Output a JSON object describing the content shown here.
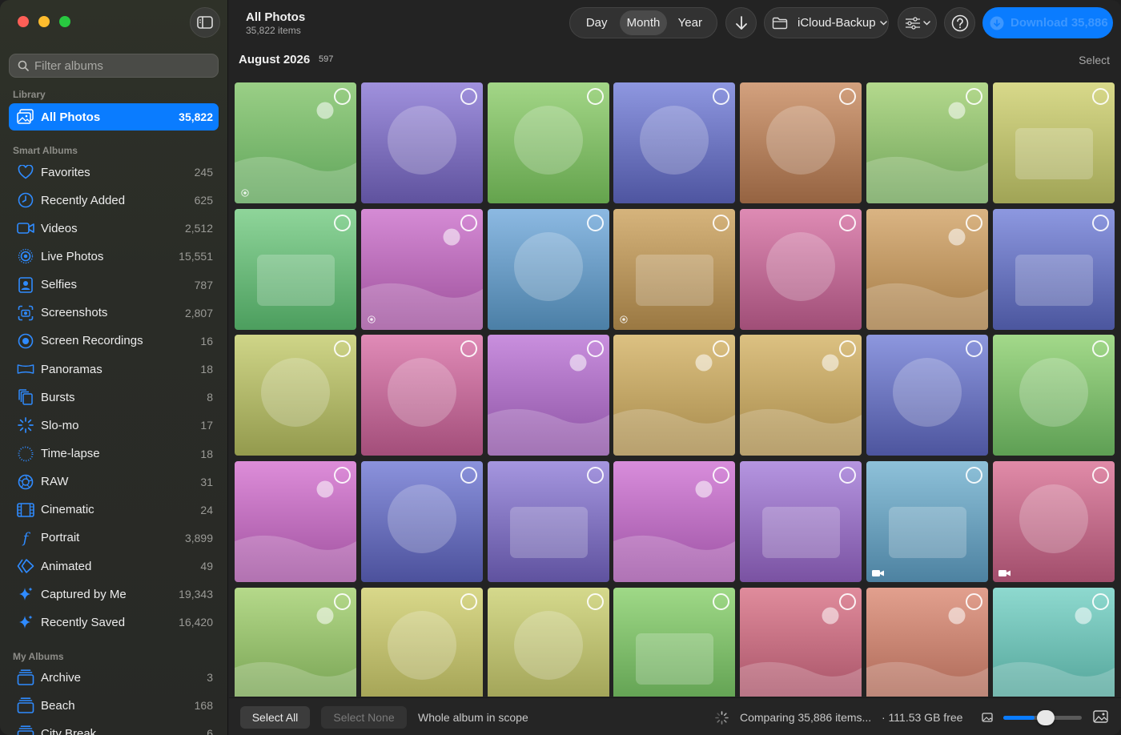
{
  "window": {
    "title": "All Photos",
    "subtitle": "35,822 items"
  },
  "sidebar": {
    "filter_placeholder": "Filter albums",
    "library_label": "Library",
    "library": [
      {
        "label": "All Photos",
        "count": "35,822",
        "icon": "photos-icon",
        "active": true
      }
    ],
    "smart_label": "Smart Albums",
    "smart": [
      {
        "label": "Favorites",
        "count": "245",
        "icon": "heart-icon"
      },
      {
        "label": "Recently Added",
        "count": "625",
        "icon": "clock-icon"
      },
      {
        "label": "Videos",
        "count": "2,512",
        "icon": "video-icon"
      },
      {
        "label": "Live Photos",
        "count": "15,551",
        "icon": "live-photo-icon"
      },
      {
        "label": "Selfies",
        "count": "787",
        "icon": "selfie-icon"
      },
      {
        "label": "Screenshots",
        "count": "2,807",
        "icon": "screenshot-icon"
      },
      {
        "label": "Screen Recordings",
        "count": "16",
        "icon": "screen-recording-icon"
      },
      {
        "label": "Panoramas",
        "count": "18",
        "icon": "panorama-icon"
      },
      {
        "label": "Bursts",
        "count": "8",
        "icon": "bursts-icon"
      },
      {
        "label": "Slo-mo",
        "count": "17",
        "icon": "slomo-icon"
      },
      {
        "label": "Time-lapse",
        "count": "18",
        "icon": "timelapse-icon"
      },
      {
        "label": "RAW",
        "count": "31",
        "icon": "raw-icon"
      },
      {
        "label": "Cinematic",
        "count": "24",
        "icon": "cinematic-icon"
      },
      {
        "label": "Portrait",
        "count": "3,899",
        "icon": "portrait-icon"
      },
      {
        "label": "Animated",
        "count": "49",
        "icon": "animated-icon"
      },
      {
        "label": "Captured by Me",
        "count": "19,343",
        "icon": "sparkle-icon"
      },
      {
        "label": "Recently Saved",
        "count": "16,420",
        "icon": "sparkle-icon"
      }
    ],
    "albums_label": "My Albums",
    "albums": [
      {
        "label": "Archive",
        "count": "3",
        "icon": "album-stack-icon"
      },
      {
        "label": "Beach",
        "count": "168",
        "icon": "album-stack-icon"
      },
      {
        "label": "City Break",
        "count": "6",
        "icon": "album-stack-icon"
      }
    ]
  },
  "toolbar": {
    "segments": [
      {
        "label": "Day"
      },
      {
        "label": "Month",
        "selected": true
      },
      {
        "label": "Year"
      }
    ],
    "folder_label": "iCloud-Backup",
    "download_label": "Download 35,886"
  },
  "content": {
    "month_title": "August 2026",
    "month_count": "597",
    "select_label": "Select"
  },
  "tiles": [
    {
      "top": "#9acf86",
      "bot": "#5fa45a",
      "shape": "dot",
      "badge": "live"
    },
    {
      "top": "#a091dd",
      "bot": "#5f529e",
      "shape": "circle"
    },
    {
      "top": "#a3d687",
      "bot": "#64a34d",
      "shape": "circle"
    },
    {
      "top": "#8e97e0",
      "bot": "#4e55a0",
      "shape": "circle"
    },
    {
      "top": "#d3a17e",
      "bot": "#956341",
      "shape": "circle"
    },
    {
      "top": "#b4d98d",
      "bot": "#6fa359",
      "shape": "dot"
    },
    {
      "top": "#d8d98a",
      "bot": "#a0a456",
      "shape": "rect"
    },
    {
      "top": "#8fd59a",
      "bot": "#4c9e5e",
      "shape": "rect"
    },
    {
      "top": "#d58bd5",
      "bot": "#9d509b",
      "shape": "dot",
      "badge": "live"
    },
    {
      "top": "#8cb9e2",
      "bot": "#4b7fa6",
      "shape": "circle"
    },
    {
      "top": "#d6b47c",
      "bot": "#9a7842",
      "shape": "rect",
      "badge": "live"
    },
    {
      "top": "#de8bb4",
      "bot": "#a04e77",
      "shape": "circle"
    },
    {
      "top": "#dab483",
      "bot": "#a37a44",
      "shape": "dot"
    },
    {
      "top": "#8d98e0",
      "bot": "#4b569e",
      "shape": "rect"
    },
    {
      "top": "#cfd588",
      "bot": "#939a4d",
      "shape": "circle"
    },
    {
      "top": "#e08bb7",
      "bot": "#a34e7a",
      "shape": "circle"
    },
    {
      "top": "#c98fde",
      "bot": "#8c52a3",
      "shape": "dot"
    },
    {
      "top": "#dcc182",
      "bot": "#a6894a",
      "shape": "dot"
    },
    {
      "top": "#dcc182",
      "bot": "#a6894a",
      "shape": "dot"
    },
    {
      "top": "#8d97de",
      "bot": "#4d559e",
      "shape": "circle"
    },
    {
      "top": "#a3d98a",
      "bot": "#5e9f54",
      "shape": "circle"
    },
    {
      "top": "#dd8dd9",
      "bot": "#9f509e",
      "shape": "dot"
    },
    {
      "top": "#8b92dc",
      "bot": "#4c519c",
      "shape": "circle"
    },
    {
      "top": "#a596df",
      "bot": "#5f529f",
      "shape": "rect"
    },
    {
      "top": "#d88ddb",
      "bot": "#9c51a3",
      "shape": "dot"
    },
    {
      "top": "#b595e0",
      "bot": "#7a52a2",
      "shape": "rect"
    },
    {
      "top": "#8ec1d9",
      "bot": "#4d82a1",
      "shape": "rect",
      "badge": "video"
    },
    {
      "top": "#e08ba8",
      "bot": "#a24e6c",
      "shape": "circle",
      "badge": "video"
    },
    {
      "top": "#b5d98a",
      "bot": "#739f4f",
      "shape": "dot"
    },
    {
      "top": "#d9d88a",
      "bot": "#a1a052",
      "shape": "circle"
    },
    {
      "top": "#d5d98c",
      "bot": "#9ea054",
      "shape": "circle"
    },
    {
      "top": "#9fd987",
      "bot": "#5e9e4f",
      "shape": "rect"
    },
    {
      "top": "#e08c9c",
      "bot": "#a34e63",
      "shape": "dot"
    },
    {
      "top": "#e2a08e",
      "bot": "#a86452",
      "shape": "dot"
    },
    {
      "top": "#8ed9cf",
      "bot": "#4ea095",
      "shape": "dot"
    }
  ],
  "bottombar": {
    "select_all": "Select All",
    "select_none": "Select None",
    "scope": "Whole album in scope",
    "status": "Comparing 35,886 items...",
    "free": "· 111.53 GB free",
    "zoom_level": 0.4
  }
}
